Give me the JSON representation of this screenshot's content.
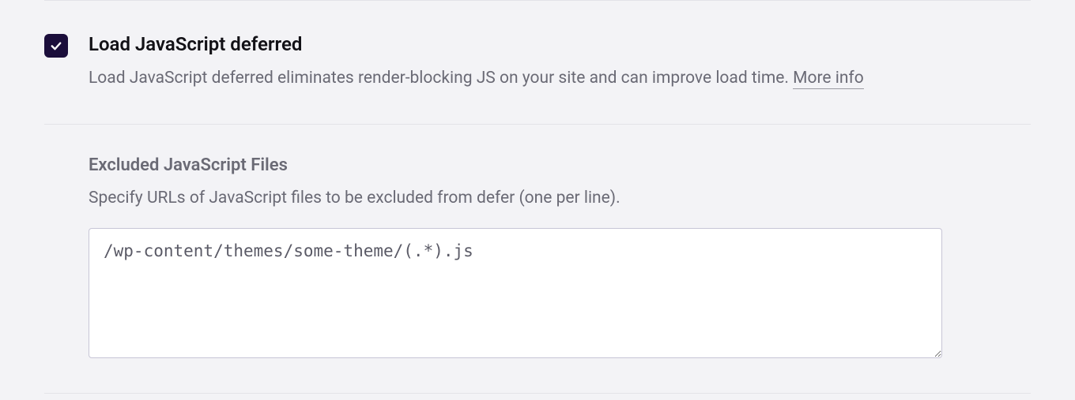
{
  "defer": {
    "checked": true,
    "title": "Load JavaScript deferred",
    "description_pre": "Load JavaScript deferred eliminates render-blocking JS on your site and can improve load time. ",
    "more_info_label": "More info"
  },
  "excluded": {
    "title": "Excluded JavaScript Files",
    "description": "Specify URLs of JavaScript files to be excluded from defer (one per line).",
    "value": "/wp-content/themes/some-theme/(.*).js"
  },
  "colors": {
    "checkbox_bg": "#1b0e3b",
    "page_bg": "#f3f3f6",
    "text_primary": "#121116",
    "text_muted": "#6a6a75"
  }
}
